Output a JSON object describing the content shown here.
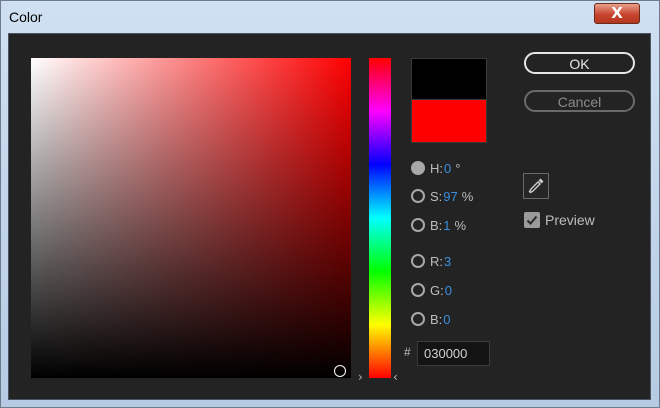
{
  "window": {
    "title": "Color",
    "close_glyph": "X"
  },
  "picker": {
    "hue_arrow_left": "›",
    "hue_arrow_right": "‹",
    "old_color": "#000000",
    "new_color": "#FF0000"
  },
  "fields": [
    {
      "label": "H:",
      "value": "0",
      "unit": "°",
      "selected": true
    },
    {
      "label": "S:",
      "value": "97",
      "unit": "%",
      "selected": false
    },
    {
      "label": "B:",
      "value": "1",
      "unit": "%",
      "selected": false
    },
    {
      "label": "R:",
      "value": "3",
      "unit": "",
      "selected": false
    },
    {
      "label": "G:",
      "value": "0",
      "unit": "",
      "selected": false
    },
    {
      "label": "B:",
      "value": "0",
      "unit": "",
      "selected": false
    }
  ],
  "hex": {
    "prefix": "#",
    "value": "030000"
  },
  "buttons": {
    "ok": "OK",
    "cancel": "Cancel"
  },
  "eyedropper": {
    "icon": "eyedropper-icon"
  },
  "preview": {
    "label": "Preview",
    "checked": true
  }
}
